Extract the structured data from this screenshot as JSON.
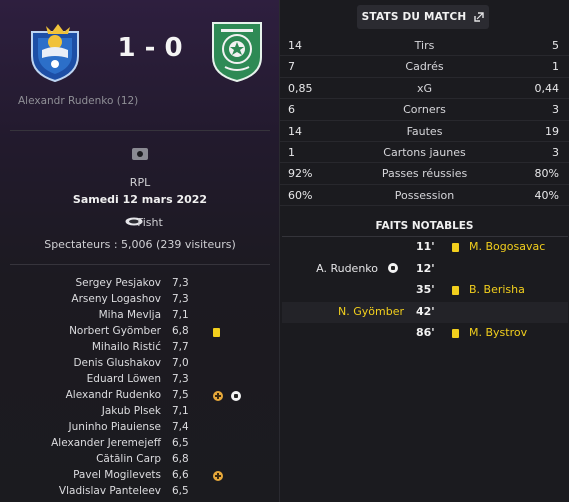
{
  "match": {
    "home_crest": "sochi-crest-icon",
    "away_crest": "akhmat-crest-icon",
    "score": "1 - 0",
    "home_scorer": "Alexandr Rudenko (12)",
    "competition": "RPL",
    "date": "Samedi 12 mars 2022",
    "stadium": "Fisht",
    "attendance": "Spectateurs : 5,006 (239 visiteurs)"
  },
  "lineup": [
    {
      "name": "Sergey Pesjakov",
      "rating": "7,3",
      "icons": []
    },
    {
      "name": "Arseny Logashov",
      "rating": "7,3",
      "icons": []
    },
    {
      "name": "Miha Mevlja",
      "rating": "7,1",
      "icons": []
    },
    {
      "name": "Norbert Gyömber",
      "rating": "6,8",
      "icons": [
        "yellow-card-icon"
      ]
    },
    {
      "name": "Mihailo Ristić",
      "rating": "7,7",
      "icons": []
    },
    {
      "name": "Denis Glushakov",
      "rating": "7,0",
      "icons": []
    },
    {
      "name": "Eduard Löwen",
      "rating": "7,3",
      "icons": []
    },
    {
      "name": "Alexandr Rudenko",
      "rating": "7,5",
      "icons": [
        "substitution-icon",
        "goal-ball-icon"
      ]
    },
    {
      "name": "Jakub Plsek",
      "rating": "7,1",
      "icons": []
    },
    {
      "name": "Juninho Piauiense",
      "rating": "7,4",
      "icons": []
    },
    {
      "name": "Alexander Jeremejeff",
      "rating": "6,5",
      "icons": []
    },
    {
      "name": "Cătălin Carp",
      "rating": "6,8",
      "icons": []
    },
    {
      "name": "Pavel Mogilevets",
      "rating": "6,6",
      "icons": [
        "substitution-icon"
      ]
    },
    {
      "name": "Vladislav Panteleev",
      "rating": "6,5",
      "icons": []
    }
  ],
  "stats": {
    "title": "STATS DU MATCH",
    "rows": [
      {
        "home": "14",
        "label": "Tirs",
        "away": "5"
      },
      {
        "home": "7",
        "label": "Cadrés",
        "away": "1"
      },
      {
        "home": "0,85",
        "label": "xG",
        "away": "0,44"
      },
      {
        "home": "6",
        "label": "Corners",
        "away": "3"
      },
      {
        "home": "14",
        "label": "Fautes",
        "away": "19"
      },
      {
        "home": "1",
        "label": "Cartons jaunes",
        "away": "3"
      },
      {
        "home": "92%",
        "label": "Passes réussies",
        "away": "80%"
      },
      {
        "home": "60%",
        "label": "Possession",
        "away": "40%"
      }
    ]
  },
  "events": {
    "title": "FAITS NOTABLES",
    "items": [
      {
        "minute": "11'",
        "side": "away",
        "player": "M. Bogosavac",
        "icon": "yellow-card-icon"
      },
      {
        "minute": "12'",
        "side": "home",
        "player": "A. Rudenko",
        "icon": "goal-ball-icon"
      },
      {
        "minute": "35'",
        "side": "away",
        "player": "B. Berisha",
        "icon": "yellow-card-icon"
      },
      {
        "minute": "42'",
        "side": "home",
        "player": "N. Gyömber",
        "icon": "yellow-card-icon"
      },
      {
        "minute": "86'",
        "side": "away",
        "player": "M. Bystrov",
        "icon": "yellow-card-icon"
      }
    ]
  },
  "colors": {
    "yellow_card": "#f2cf1d",
    "substitution": "#e8a93a",
    "home_accent": "#2c6fc9",
    "away_accent": "#2e8a55"
  }
}
